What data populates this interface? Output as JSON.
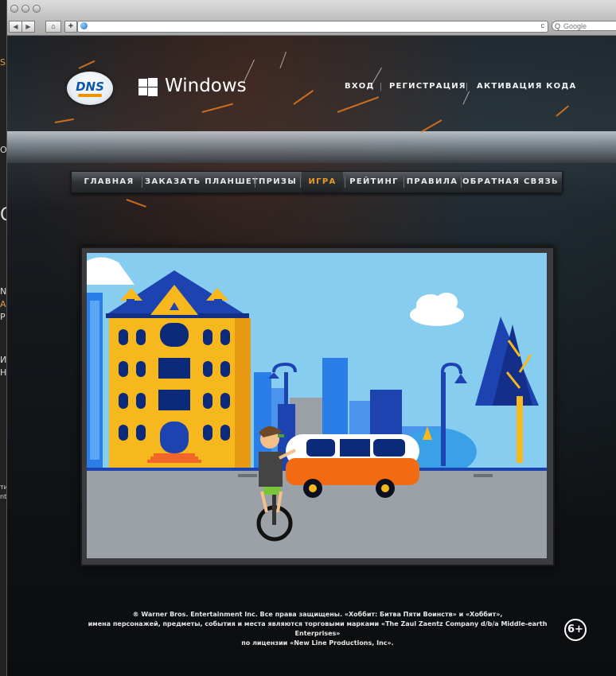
{
  "browser": {
    "search_placeholder": "Google",
    "reload_glyph": "c"
  },
  "background_window": {
    "fragments": [
      "S",
      "O",
      "O",
      "NS",
      "A",
      "P",
      "И",
      "НА",
      "ти",
      "nt"
    ]
  },
  "site": {
    "brand_logo_text": "DNS",
    "partner_logo_text": "Windows",
    "top_nav": [
      "ВХОД",
      "РЕГИСТРАЦИЯ",
      "АКТИВАЦИЯ КОДА"
    ],
    "main_nav": [
      {
        "label": "ГЛАВНАЯ",
        "active": false
      },
      {
        "label": "ЗАКАЗАТЬ ПЛАНШЕТ",
        "active": false
      },
      {
        "label": "ПРИЗЫ",
        "active": false
      },
      {
        "label": "ИГРА",
        "active": true
      },
      {
        "label": "РЕЙТИНГ",
        "active": false
      },
      {
        "label": "ПРАВИЛА",
        "active": false
      },
      {
        "label": "ОБРАТНАЯ СВЯЗЬ",
        "active": false
      }
    ],
    "active_color": "#e79a29",
    "footer": {
      "line1": "® Warner Bros. Entertainment Inc. Все права защищены. «Хоббит: Битва Пяти Воинств» и «Хоббит»,",
      "line2": "имена персонажей, предметы, события и места являются торговыми марками «The Zaul Zaentz Company d/b/a Middle-earth Enterprises»",
      "line3": "по лицензии «New Line Productions, Inc»."
    },
    "age_rating": "6+"
  },
  "game": {
    "scene": "city street with unicyclist and orange-white van",
    "colors": {
      "sky": "#87cdf0",
      "building": "#f6b81c",
      "roof": "#1d43b0",
      "road": "#9ba1a6",
      "van_orange": "#f26a11"
    }
  }
}
